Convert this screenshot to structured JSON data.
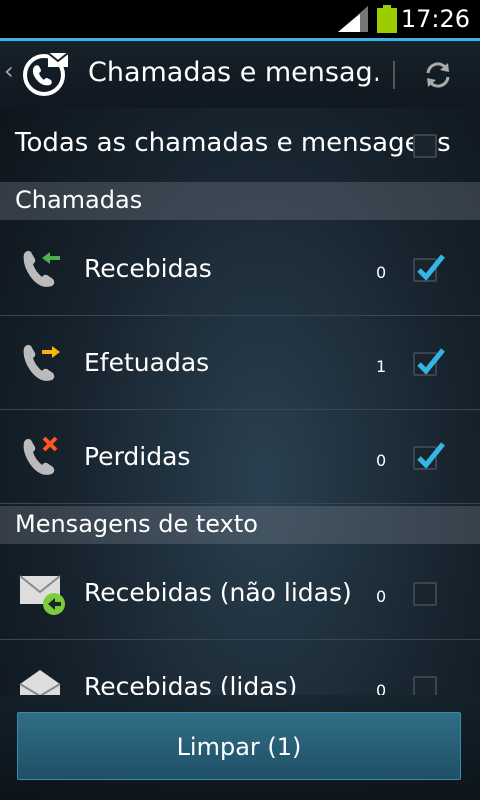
{
  "status": {
    "time": "17:26"
  },
  "actionbar": {
    "title": "Chamadas e mensag…"
  },
  "all": {
    "label": "Todas as chamadas e mensagens",
    "checked": false
  },
  "sections": {
    "calls": "Chamadas",
    "texts": "Mensagens de texto"
  },
  "calls": [
    {
      "label": "Recebidas",
      "count": "0",
      "checked": true,
      "icon": "incoming-call-icon",
      "accent": "#4caf50"
    },
    {
      "label": "Efetuadas",
      "count": "1",
      "checked": true,
      "icon": "outgoing-call-icon",
      "accent": "#ffb300"
    },
    {
      "label": "Perdidas",
      "count": "0",
      "checked": true,
      "icon": "missed-call-icon",
      "accent": "#ff5722"
    }
  ],
  "texts": [
    {
      "label": "Recebidas (não lidas)",
      "count": "0",
      "checked": false,
      "icon": "unread-message-icon"
    },
    {
      "label": "Recebidas (lidas)",
      "count": "0",
      "checked": false,
      "icon": "read-message-icon"
    }
  ],
  "button": {
    "label": "Limpar (1)"
  },
  "colors": {
    "accent": "#33b5e5",
    "button": "#2a6178"
  }
}
